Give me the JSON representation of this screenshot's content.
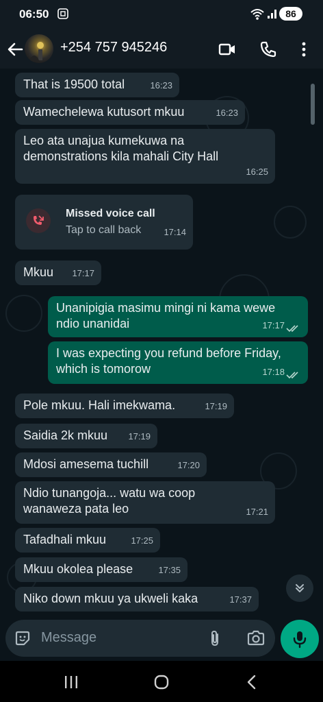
{
  "status": {
    "time": "06:50",
    "battery": "86"
  },
  "header": {
    "contact": "+254 757 945246"
  },
  "messages": [
    {
      "dir": "in",
      "text": "That is 19500 total",
      "time": "16:23"
    },
    {
      "dir": "in",
      "text": "Wamechelewa kutusort mkuu",
      "time": "16:23"
    },
    {
      "dir": "in",
      "text": "Leo ata unajua kumekuwa na demonstrations kila mahali City Hall",
      "time": "16:25"
    },
    {
      "dir": "call",
      "title": "Missed voice call",
      "sub": "Tap to call back",
      "time": "17:14"
    },
    {
      "dir": "in",
      "text": "Mkuu",
      "time": "17:17"
    },
    {
      "dir": "out",
      "text": "Unanipigia masimu mingi ni kama wewe ndio unanidai",
      "time": "17:17"
    },
    {
      "dir": "out",
      "text": "I was expecting you refund before Friday, which is tomorow",
      "time": "17:18"
    },
    {
      "dir": "in",
      "text": "Pole mkuu. Hali imekwama.",
      "time": "17:19"
    },
    {
      "dir": "in",
      "text": "Saidia 2k mkuu",
      "time": "17:19"
    },
    {
      "dir": "in",
      "text": "Mdosi amesema tuchill",
      "time": "17:20"
    },
    {
      "dir": "in",
      "text": "Ndio tunangoja... watu wa coop wanaweza pata leo",
      "time": "17:21"
    },
    {
      "dir": "in",
      "text": "Tafadhali mkuu",
      "time": "17:25"
    },
    {
      "dir": "in",
      "text": "Mkuu okolea please",
      "time": "17:35"
    },
    {
      "dir": "in",
      "text": "Niko down mkuu ya ukweli kaka",
      "time": "17:37"
    }
  ],
  "input": {
    "placeholder": "Message"
  },
  "icons": {
    "back": "arrow-left-icon",
    "video": "video-camera-icon",
    "call": "phone-icon",
    "menu": "more-vert-icon",
    "emoji": "sticker-icon",
    "attach": "paperclip-icon",
    "camera": "camera-icon",
    "mic": "microphone-icon"
  },
  "colors": {
    "incoming": "#1f2c34",
    "outgoing": "#005c4b",
    "accent": "#00a884",
    "missed": "#f15c6d"
  }
}
